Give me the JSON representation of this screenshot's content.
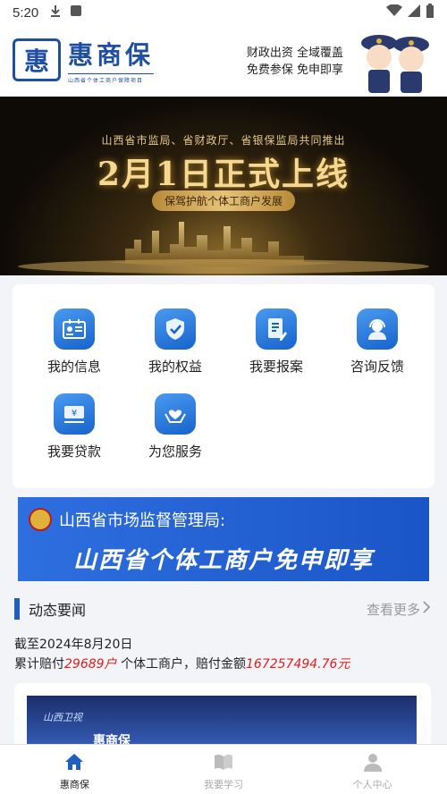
{
  "status_bar": {
    "time": "5:20"
  },
  "header": {
    "logo_mark": "惠",
    "logo_title": "惠商保",
    "logo_subtitle": "山西省个体工商户保障项目",
    "slogan_line1": "财政出资 全域覆盖",
    "slogan_line2": "免费参保 免申即享"
  },
  "banner": {
    "subtitle": "山西省市监局、省财政厅、省银保监局共同推出",
    "title": "2月1日正式上线",
    "pill": "保驾护航个体工商户发展"
  },
  "services": [
    {
      "label": "我的信息",
      "icon": "id-card-icon"
    },
    {
      "label": "我的权益",
      "icon": "shield-check-icon"
    },
    {
      "label": "我要报案",
      "icon": "document-edit-icon"
    },
    {
      "label": "咨询反馈",
      "icon": "customer-service-icon"
    },
    {
      "label": "我要贷款",
      "icon": "loan-yen-icon"
    },
    {
      "label": "为您服务",
      "icon": "hands-heart-icon"
    }
  ],
  "notice": {
    "line1": "山西省市场监督管理局:",
    "line2": "山西省个体工商户免申即享"
  },
  "news": {
    "section_title": "动态要闻",
    "more_label": "查看更多",
    "date_line": "截至2024年8月20日",
    "stat_prefix": "累计赔付",
    "stat_households": "29689户",
    "stat_middle": " 个体工商户，赔付金额",
    "stat_amount": "167257494.76元",
    "card_stage_text": "山西卫视",
    "card_logo_text": "惠商保"
  },
  "bottom_nav": [
    {
      "label": "惠商保",
      "icon": "home-icon",
      "active": true
    },
    {
      "label": "我要学习",
      "icon": "book-icon",
      "active": false
    },
    {
      "label": "个人中心",
      "icon": "person-icon",
      "active": false
    }
  ],
  "colors": {
    "brand_blue": "#1f4fa0",
    "accent_blue": "#1f5fc2",
    "highlight_red": "#e02020",
    "banner_gold": "#f6d890"
  }
}
